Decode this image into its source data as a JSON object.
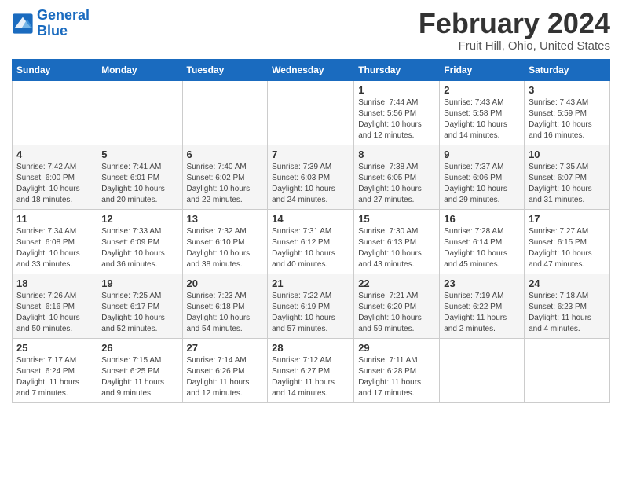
{
  "logo": {
    "line1": "General",
    "line2": "Blue"
  },
  "title": "February 2024",
  "location": "Fruit Hill, Ohio, United States",
  "weekdays": [
    "Sunday",
    "Monday",
    "Tuesday",
    "Wednesday",
    "Thursday",
    "Friday",
    "Saturday"
  ],
  "weeks": [
    [
      {
        "day": "",
        "info": ""
      },
      {
        "day": "",
        "info": ""
      },
      {
        "day": "",
        "info": ""
      },
      {
        "day": "",
        "info": ""
      },
      {
        "day": "1",
        "info": "Sunrise: 7:44 AM\nSunset: 5:56 PM\nDaylight: 10 hours\nand 12 minutes."
      },
      {
        "day": "2",
        "info": "Sunrise: 7:43 AM\nSunset: 5:58 PM\nDaylight: 10 hours\nand 14 minutes."
      },
      {
        "day": "3",
        "info": "Sunrise: 7:43 AM\nSunset: 5:59 PM\nDaylight: 10 hours\nand 16 minutes."
      }
    ],
    [
      {
        "day": "4",
        "info": "Sunrise: 7:42 AM\nSunset: 6:00 PM\nDaylight: 10 hours\nand 18 minutes."
      },
      {
        "day": "5",
        "info": "Sunrise: 7:41 AM\nSunset: 6:01 PM\nDaylight: 10 hours\nand 20 minutes."
      },
      {
        "day": "6",
        "info": "Sunrise: 7:40 AM\nSunset: 6:02 PM\nDaylight: 10 hours\nand 22 minutes."
      },
      {
        "day": "7",
        "info": "Sunrise: 7:39 AM\nSunset: 6:03 PM\nDaylight: 10 hours\nand 24 minutes."
      },
      {
        "day": "8",
        "info": "Sunrise: 7:38 AM\nSunset: 6:05 PM\nDaylight: 10 hours\nand 27 minutes."
      },
      {
        "day": "9",
        "info": "Sunrise: 7:37 AM\nSunset: 6:06 PM\nDaylight: 10 hours\nand 29 minutes."
      },
      {
        "day": "10",
        "info": "Sunrise: 7:35 AM\nSunset: 6:07 PM\nDaylight: 10 hours\nand 31 minutes."
      }
    ],
    [
      {
        "day": "11",
        "info": "Sunrise: 7:34 AM\nSunset: 6:08 PM\nDaylight: 10 hours\nand 33 minutes."
      },
      {
        "day": "12",
        "info": "Sunrise: 7:33 AM\nSunset: 6:09 PM\nDaylight: 10 hours\nand 36 minutes."
      },
      {
        "day": "13",
        "info": "Sunrise: 7:32 AM\nSunset: 6:10 PM\nDaylight: 10 hours\nand 38 minutes."
      },
      {
        "day": "14",
        "info": "Sunrise: 7:31 AM\nSunset: 6:12 PM\nDaylight: 10 hours\nand 40 minutes."
      },
      {
        "day": "15",
        "info": "Sunrise: 7:30 AM\nSunset: 6:13 PM\nDaylight: 10 hours\nand 43 minutes."
      },
      {
        "day": "16",
        "info": "Sunrise: 7:28 AM\nSunset: 6:14 PM\nDaylight: 10 hours\nand 45 minutes."
      },
      {
        "day": "17",
        "info": "Sunrise: 7:27 AM\nSunset: 6:15 PM\nDaylight: 10 hours\nand 47 minutes."
      }
    ],
    [
      {
        "day": "18",
        "info": "Sunrise: 7:26 AM\nSunset: 6:16 PM\nDaylight: 10 hours\nand 50 minutes."
      },
      {
        "day": "19",
        "info": "Sunrise: 7:25 AM\nSunset: 6:17 PM\nDaylight: 10 hours\nand 52 minutes."
      },
      {
        "day": "20",
        "info": "Sunrise: 7:23 AM\nSunset: 6:18 PM\nDaylight: 10 hours\nand 54 minutes."
      },
      {
        "day": "21",
        "info": "Sunrise: 7:22 AM\nSunset: 6:19 PM\nDaylight: 10 hours\nand 57 minutes."
      },
      {
        "day": "22",
        "info": "Sunrise: 7:21 AM\nSunset: 6:20 PM\nDaylight: 10 hours\nand 59 minutes."
      },
      {
        "day": "23",
        "info": "Sunrise: 7:19 AM\nSunset: 6:22 PM\nDaylight: 11 hours\nand 2 minutes."
      },
      {
        "day": "24",
        "info": "Sunrise: 7:18 AM\nSunset: 6:23 PM\nDaylight: 11 hours\nand 4 minutes."
      }
    ],
    [
      {
        "day": "25",
        "info": "Sunrise: 7:17 AM\nSunset: 6:24 PM\nDaylight: 11 hours\nand 7 minutes."
      },
      {
        "day": "26",
        "info": "Sunrise: 7:15 AM\nSunset: 6:25 PM\nDaylight: 11 hours\nand 9 minutes."
      },
      {
        "day": "27",
        "info": "Sunrise: 7:14 AM\nSunset: 6:26 PM\nDaylight: 11 hours\nand 12 minutes."
      },
      {
        "day": "28",
        "info": "Sunrise: 7:12 AM\nSunset: 6:27 PM\nDaylight: 11 hours\nand 14 minutes."
      },
      {
        "day": "29",
        "info": "Sunrise: 7:11 AM\nSunset: 6:28 PM\nDaylight: 11 hours\nand 17 minutes."
      },
      {
        "day": "",
        "info": ""
      },
      {
        "day": "",
        "info": ""
      }
    ]
  ]
}
